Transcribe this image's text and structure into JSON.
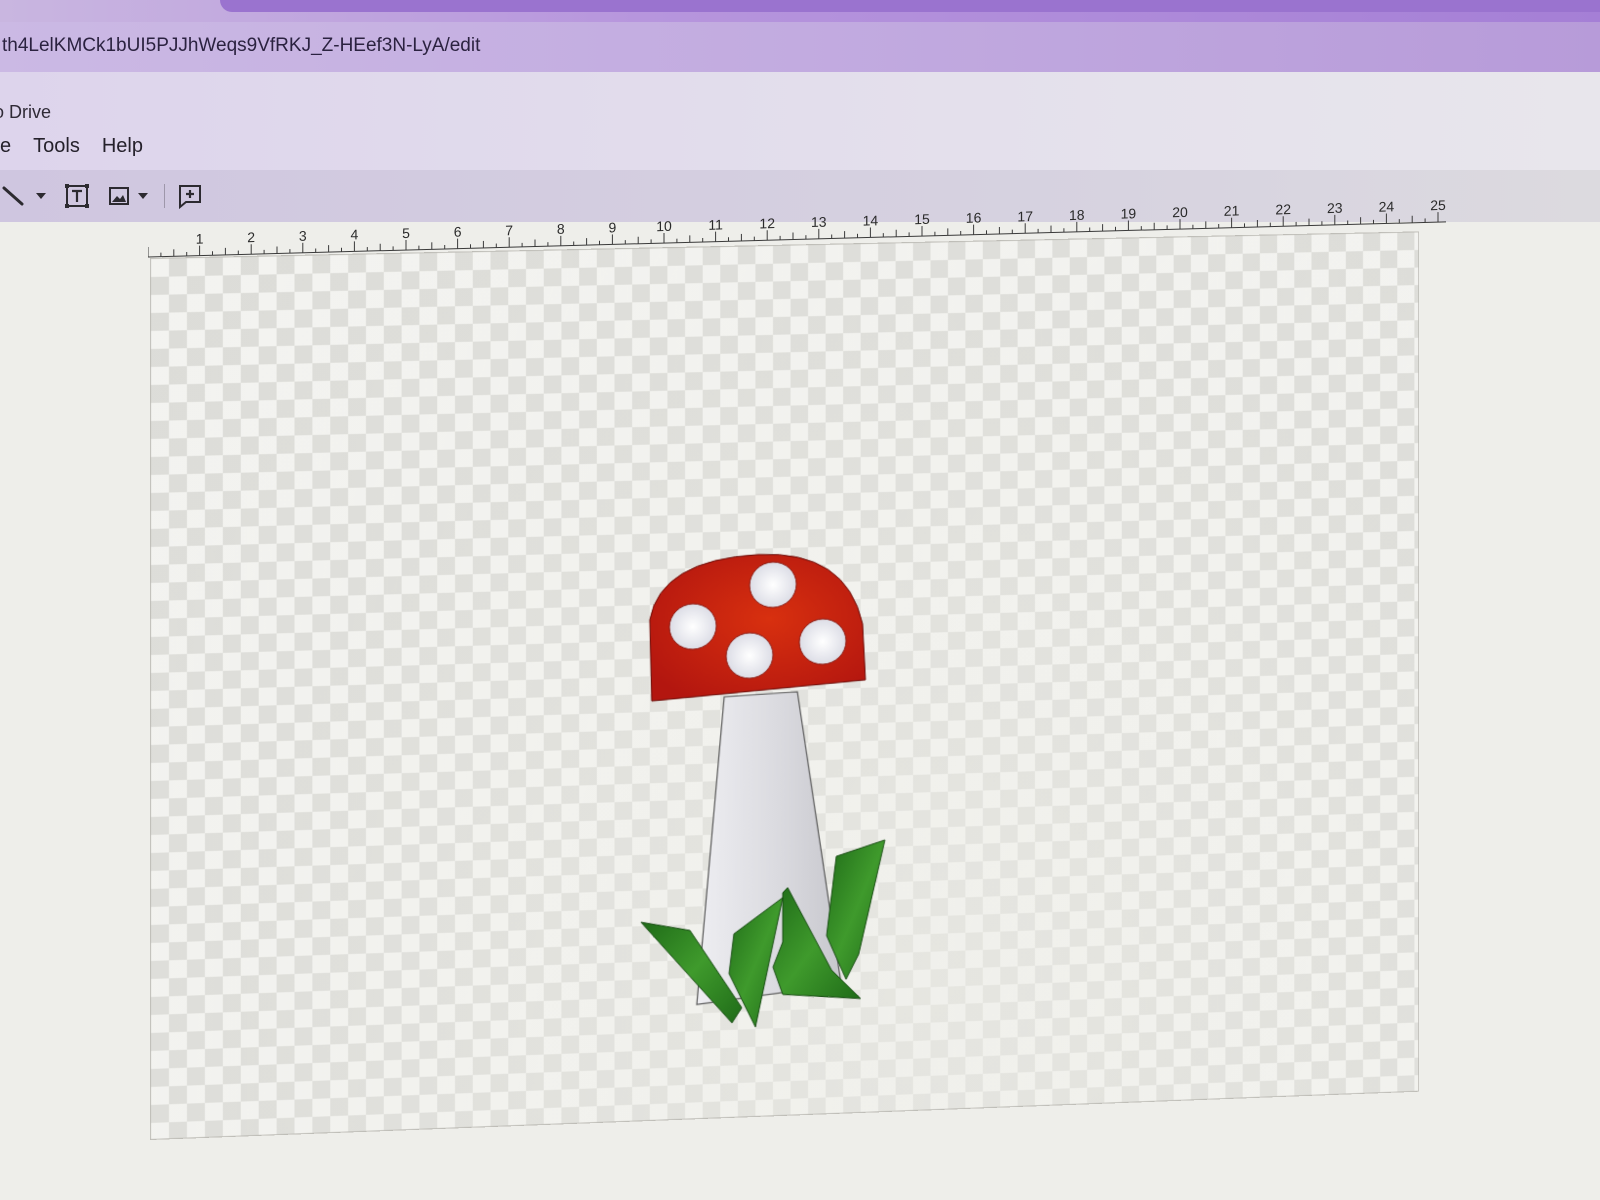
{
  "browser": {
    "url": "th4LelKMCk1bUI5PJJhWeqs9VfRKJ_Z-HEef3N-LyA/edit"
  },
  "app": {
    "breadcrumb": "o Drive",
    "menu": [
      {
        "label": "e"
      },
      {
        "label": "Tools"
      },
      {
        "label": "Help"
      }
    ]
  },
  "toolbar": {
    "tools": [
      "line-icon",
      "dropdown-caret-icon",
      "text-box-icon",
      "image-icon",
      "dropdown-caret-icon",
      "add-comment-icon"
    ]
  },
  "ruler": {
    "labels": [
      "1",
      "2",
      "3",
      "4",
      "5",
      "6",
      "7",
      "8",
      "9",
      "10",
      "11",
      "12",
      "13",
      "14",
      "15",
      "16",
      "17",
      "18",
      "19",
      "20",
      "21",
      "22",
      "23",
      "24",
      "25"
    ]
  },
  "drawing": {
    "subject": "mushroom",
    "colors": {
      "cap": "#b3160f",
      "cap_highlight": "#d8300f",
      "spots": "#dcdde6",
      "stem": "#d9d9de",
      "grass": "#3f9a2c",
      "grass_dark": "#1f6b18"
    },
    "spot_count": 4,
    "grass_blades": 4
  }
}
